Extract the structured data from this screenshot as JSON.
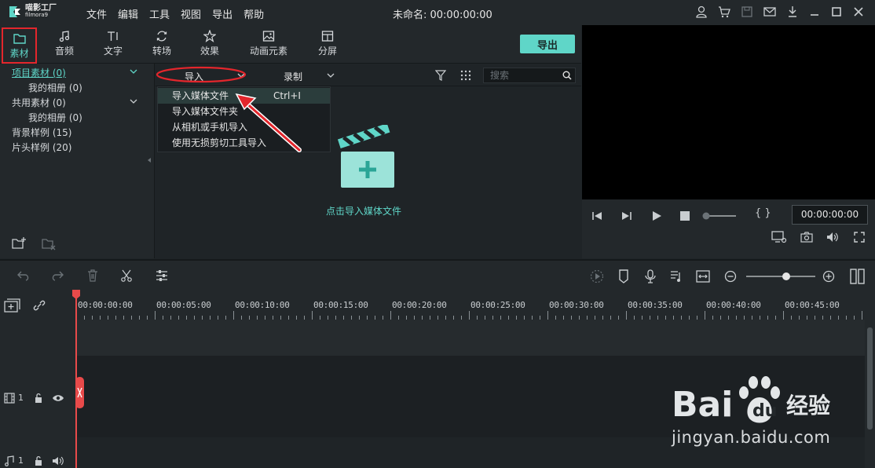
{
  "app": {
    "logo_line1": "喵影工厂",
    "logo_line2": "filmora9",
    "menu": [
      "文件",
      "编辑",
      "工具",
      "视图",
      "导出",
      "帮助"
    ],
    "title": "未命名: 00:00:00:00"
  },
  "toolbar": {
    "tabs": [
      "素材",
      "音频",
      "文字",
      "转场",
      "效果",
      "动画元素",
      "分屏"
    ],
    "export_label": "导出"
  },
  "library": {
    "items": [
      {
        "label": "项目素材 (0)",
        "expandable": true
      },
      {
        "label": "我的相册 (0)",
        "expandable": false
      },
      {
        "label": "共用素材 (0)",
        "expandable": true
      },
      {
        "label": "我的相册 (0)",
        "expandable": false
      },
      {
        "label": "背景样例 (15)",
        "expandable": false
      },
      {
        "label": "片头样例 (20)",
        "expandable": false
      }
    ]
  },
  "media": {
    "import_label": "导入",
    "record_label": "录制",
    "search_placeholder": "搜索",
    "import_menu": [
      {
        "label": "导入媒体文件",
        "shortcut": "Ctrl+I"
      },
      {
        "label": "导入媒体文件夹",
        "shortcut": ""
      },
      {
        "label": "从相机或手机导入",
        "shortcut": ""
      },
      {
        "label": "使用无损剪切工具导入",
        "shortcut": ""
      }
    ],
    "empty_hint": "点击导入媒体文件"
  },
  "preview": {
    "timecode": "00:00:00:00",
    "brackets": "{   }"
  },
  "timeline": {
    "ticks": [
      "00:00:00:00",
      "00:00:05:00",
      "00:00:10:00",
      "00:00:15:00",
      "00:00:20:00",
      "00:00:25:00",
      "00:00:30:00",
      "00:00:35:00",
      "00:00:40:00",
      "00:00:45:00"
    ],
    "video_track_label": "1",
    "audio_track_label": "1"
  },
  "watermark": {
    "brand": "Bai",
    "brand2": "du",
    "brand3": "经验",
    "url": "jingyan.baidu.com"
  },
  "colors": {
    "accent": "#5fd6c8",
    "annotation_red": "#e3262c",
    "playhead": "#e84a4a"
  }
}
